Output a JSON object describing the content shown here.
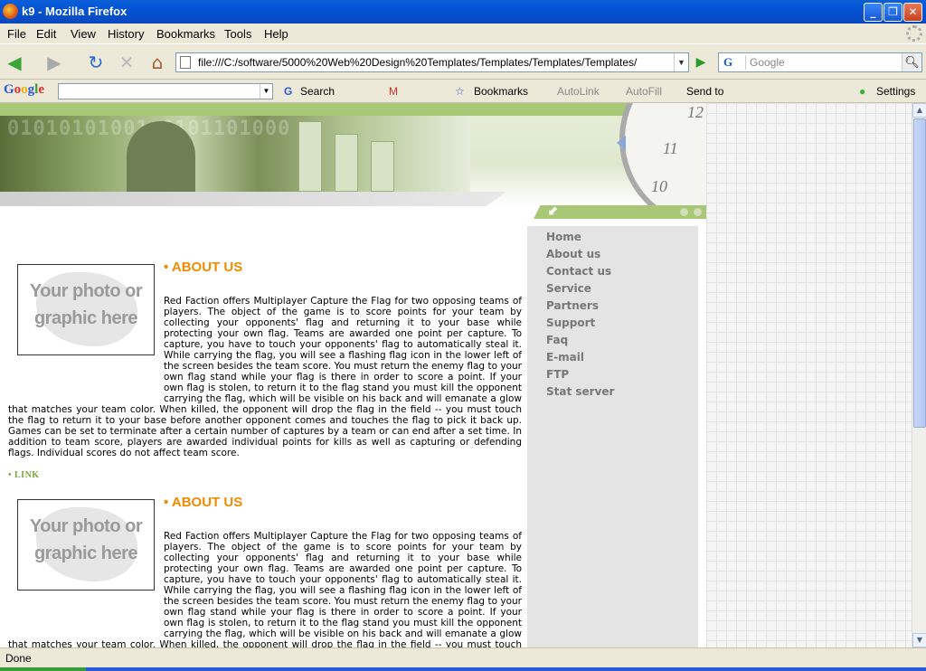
{
  "window": {
    "title": "k9 - Mozilla Firefox",
    "min": "_",
    "max": "❐",
    "close": "✕"
  },
  "menu": [
    "File",
    "Edit",
    "View",
    "History",
    "Bookmarks",
    "Tools",
    "Help"
  ],
  "nav": {
    "back": "◀",
    "forward": "▶",
    "reload": "↻",
    "stop": "✕",
    "home": "⌂",
    "url": "file:///C:/software/5000%20Web%20Design%20Templates/Templates/Templates/Templates/",
    "go": "▶",
    "search_engine": "G",
    "search_placeholder": "Google"
  },
  "gbar": {
    "logo": "Google",
    "search": "Search",
    "bookmarks": "Bookmarks",
    "autolink": "AutoLink",
    "autofill": "AutoFill",
    "sendto": "Send to",
    "settings": "Settings"
  },
  "colors": {
    "accent_green": "#a8c878",
    "heading_orange": "#f08c00",
    "link_green": "#7ca838",
    "nav_grey": "#777777"
  },
  "banner": {
    "binary": "01010101001 0101101000"
  },
  "sidebar": {
    "items": [
      "Home",
      "About us",
      "Contact us",
      "Service",
      "Partners",
      "Support",
      "Faq",
      "E-mail",
      "FTP",
      "Stat server"
    ]
  },
  "content": {
    "photo_line1": "Your photo or",
    "photo_line2": "graphic here",
    "heading": "• ABOUT US",
    "paragraph": "Red Faction offers Multiplayer Capture the Flag for two opposing teams of players. The object of the game is to score points for your team by collecting your opponents' flag and returning it to your base while protecting your own flag. Teams are awarded one point per capture. To capture, you have to touch your opponents' flag to automatically steal it. While carrying the flag, you will see a flashing flag icon in the lower left of the screen besides the team score. You must return the enemy flag to your own flag stand while your flag is there in order to score a point. If your own flag is stolen, to return it to the flag stand you must kill the opponent carrying the flag, which will be visible on his back and will emanate a glow that matches your team color. When killed, the opponent will drop the flag in the field -- you must touch the flag to return it to your base before another opponent comes and touches the flag to pick it back up. Games can be set to terminate after a certain number of captures by a team or can end after a set time. In addition to team score, players are awarded individual points for kills as well as capturing or defending flags. Individual scores do not affect team score.",
    "link": "• LINK"
  },
  "status": "Done"
}
